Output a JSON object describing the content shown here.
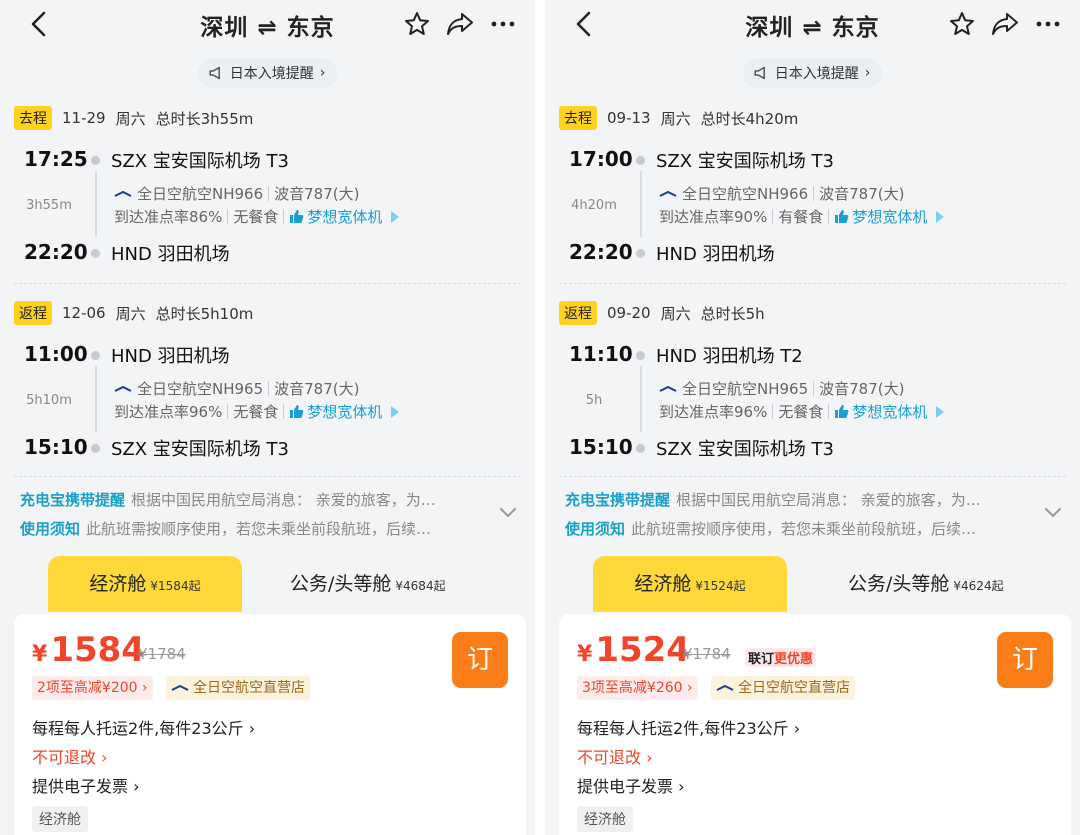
{
  "panels": [
    {
      "title": "深圳 ⇌ 东京",
      "notice": "日本入境提醒",
      "outbound": {
        "tag": "去程",
        "date": "11-29",
        "weekday": "周六",
        "total": "总时长3h55m",
        "dep_time": "17:25",
        "dep_airport": "SZX 宝安国际机场 T3",
        "duration": "3h55m",
        "airline": "全日空航空NH966",
        "aircraft": "波音787(大)",
        "ontime": "到达准点率86%",
        "meal": "无餐食",
        "feature": "梦想宽体机",
        "arr_time": "22:20",
        "arr_airport": "HND 羽田机场"
      },
      "inbound": {
        "tag": "返程",
        "date": "12-06",
        "weekday": "周六",
        "total": "总时长5h10m",
        "dep_time": "11:00",
        "dep_airport": "HND 羽田机场",
        "duration": "5h10m",
        "airline": "全日空航空NH965",
        "aircraft": "波音787(大)",
        "ontime": "到达准点率96%",
        "meal": "无餐食",
        "feature": "梦想宽体机",
        "arr_time": "15:10",
        "arr_airport": "SZX 宝安国际机场 T3"
      },
      "tips": [
        {
          "label": "充电宝携带提醒",
          "text": "根据中国民用航空局消息： 亲爱的旅客，为…"
        },
        {
          "label": "使用须知",
          "text": "此航班需按顺序使用，若您未乘坐前段航班，后续…"
        }
      ],
      "tab_economy": "经济舱",
      "tab_economy_price": "¥1584起",
      "tab_business": "公务/头等舱",
      "tab_business_price": "¥4684起",
      "card": {
        "currency": "¥",
        "price": "1584",
        "original": "¥1784",
        "promo_a": "",
        "promo_b": "",
        "discount": "2项至高减¥200",
        "store": "全日空航空直营店",
        "book": "订",
        "baggage": "每程每人托运2件,每件23公斤",
        "refund": "不可退改",
        "invoice": "提供电子发票",
        "cabin": "经济舱"
      }
    },
    {
      "title": "深圳 ⇌ 东京",
      "notice": "日本入境提醒",
      "outbound": {
        "tag": "去程",
        "date": "09-13",
        "weekday": "周六",
        "total": "总时长4h20m",
        "dep_time": "17:00",
        "dep_airport": "SZX 宝安国际机场 T3",
        "duration": "4h20m",
        "airline": "全日空航空NH966",
        "aircraft": "波音787(大)",
        "ontime": "到达准点率90%",
        "meal": "有餐食",
        "feature": "梦想宽体机",
        "arr_time": "22:20",
        "arr_airport": "HND 羽田机场"
      },
      "inbound": {
        "tag": "返程",
        "date": "09-20",
        "weekday": "周六",
        "total": "总时长5h",
        "dep_time": "11:10",
        "dep_airport": "HND 羽田机场 T2",
        "duration": "5h",
        "airline": "全日空航空NH965",
        "aircraft": "波音787(大)",
        "ontime": "到达准点率96%",
        "meal": "无餐食",
        "feature": "梦想宽体机",
        "arr_time": "15:10",
        "arr_airport": "SZX 宝安国际机场 T3"
      },
      "tips": [
        {
          "label": "充电宝携带提醒",
          "text": "根据中国民用航空局消息： 亲爱的旅客，为…"
        },
        {
          "label": "使用须知",
          "text": "此航班需按顺序使用，若您未乘坐前段航班，后续…"
        }
      ],
      "tab_economy": "经济舱",
      "tab_economy_price": "¥1524起",
      "tab_business": "公务/头等舱",
      "tab_business_price": "¥4624起",
      "card": {
        "currency": "¥",
        "price": "1524",
        "original": "¥1784",
        "promo_a": "联订",
        "promo_b": "更优惠",
        "discount": "3项至高减¥260",
        "store": "全日空航空直营店",
        "book": "订",
        "baggage": "每程每人托运2件,每件23公斤",
        "refund": "不可退改",
        "invoice": "提供电子发票",
        "cabin": "经济舱"
      }
    }
  ],
  "icons": {
    "back": "chevron-left-icon",
    "favorite": "star-icon",
    "share": "share-icon",
    "more": "more-icon",
    "notice": "megaphone-icon",
    "airline": "ana-logo-icon",
    "feature": "thumbs-up-icon",
    "expand": "chevron-down-icon"
  },
  "colors": {
    "accent_yellow": "#ffd93a",
    "price_red": "#f0452a",
    "book_orange": "#fb7d17",
    "link_blue": "#1aa1c8"
  }
}
